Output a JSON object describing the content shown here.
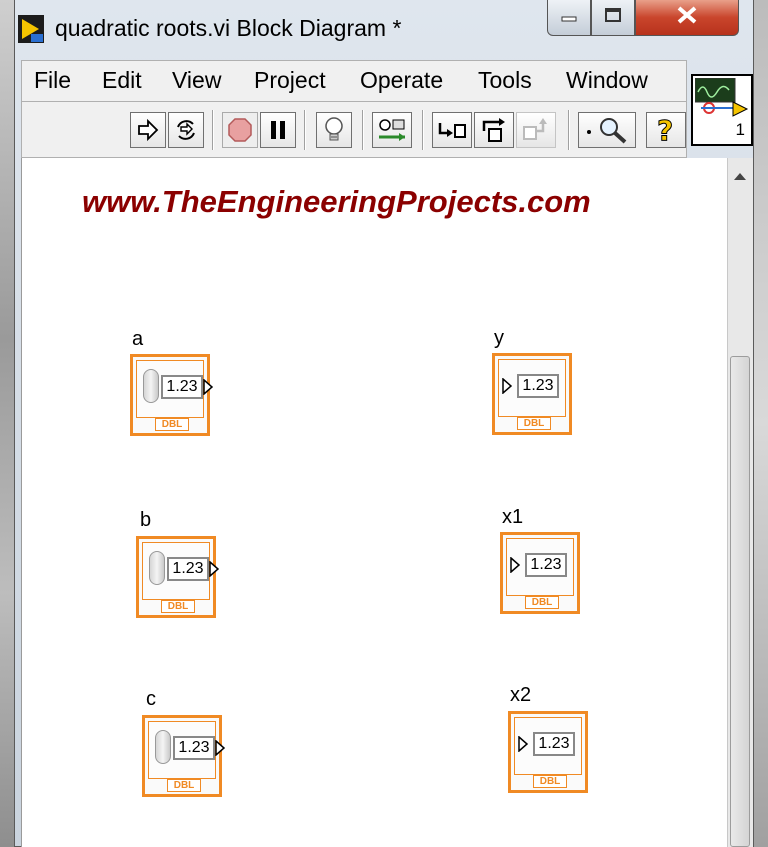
{
  "window": {
    "title": "quadratic roots.vi Block Diagram *"
  },
  "menu": {
    "items": [
      "File",
      "Edit",
      "View",
      "Project",
      "Operate",
      "Tools",
      "Window"
    ]
  },
  "toolbar": {
    "icons": [
      "run-arrow-icon",
      "run-continuously-icon",
      "abort-icon",
      "pause-icon",
      "highlight-execution-icon",
      "retain-wire-values-icon",
      "step-into-icon",
      "step-over-icon",
      "step-out-icon",
      "probe-search-icon",
      "help-icon"
    ]
  },
  "connector_pane": {
    "number": "1"
  },
  "diagram": {
    "watermark": "www.TheEngineeringProjects.com",
    "controls": [
      {
        "label": "a",
        "value": "1.23",
        "type": "DBL"
      },
      {
        "label": "b",
        "value": "1.23",
        "type": "DBL"
      },
      {
        "label": "c",
        "value": "1.23",
        "type": "DBL"
      }
    ],
    "indicators": [
      {
        "label": "y",
        "value": "1.23",
        "type": "DBL"
      },
      {
        "label": "x1",
        "value": "1.23",
        "type": "DBL"
      },
      {
        "label": "x2",
        "value": "1.23",
        "type": "DBL"
      }
    ]
  },
  "colors": {
    "terminal_border": "#f08a24",
    "watermark": "#8b0000",
    "close_button": "#c9452c"
  }
}
